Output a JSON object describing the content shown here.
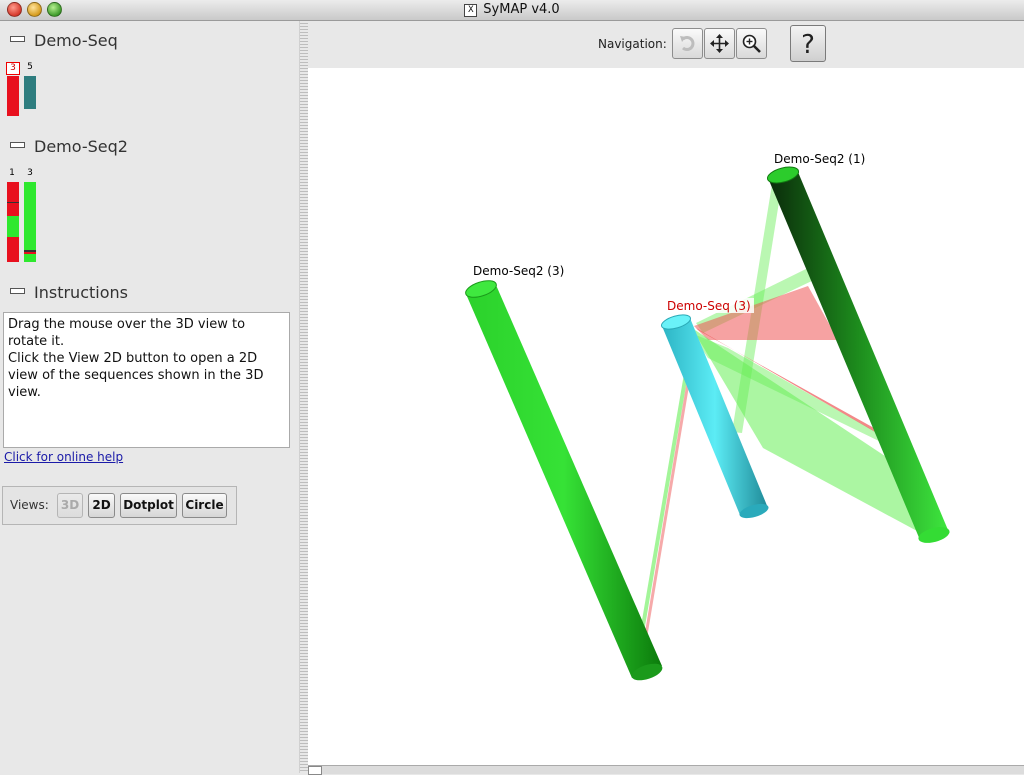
{
  "window": {
    "title": "SyMAP v4.0"
  },
  "sidebar": {
    "sections": [
      {
        "label": "Demo-Seq",
        "chromosomes": [
          {
            "num": "3",
            "selected": true,
            "color": "#e8101e"
          },
          {
            "num": "5",
            "selected": false,
            "color": "#2e7d7f"
          }
        ]
      },
      {
        "label": "Demo-Seq2",
        "chromosomes": [
          {
            "num": "1",
            "selected": false,
            "color": "#e8101e"
          },
          {
            "num": "3",
            "selected": false,
            "color": "#2ee82e"
          }
        ]
      },
      {
        "label": "Instructions"
      }
    ],
    "instructions": "Drag the mouse over the 3D view to rotate it.\nClick the View 2D button to open a 2D view of the sequences shown in the 3D view.",
    "help_link": "Click for online help",
    "views": {
      "label": "Views:",
      "buttons": [
        {
          "label": "3D",
          "enabled": false
        },
        {
          "label": "2D",
          "enabled": true
        },
        {
          "label": "Dotplot",
          "enabled": true
        },
        {
          "label": "Circle",
          "enabled": true
        }
      ]
    }
  },
  "toolbar": {
    "navigation_label": "Navigation:",
    "buttons": [
      "rotate-icon",
      "pan-icon",
      "zoom-icon"
    ],
    "help_label": "?"
  },
  "view3d": {
    "labels": {
      "seq2_chr3": "Demo-Seq2 (3)",
      "seq2_chr1": "Demo-Seq2 (1)",
      "seq_chr3": "Demo-Seq (3)"
    },
    "colors": {
      "seq2": "#22cc22",
      "seq": "#44dde8",
      "seq_label": "#cc0000",
      "sync_green": "#66ee55",
      "sync_red": "#ee5555"
    }
  }
}
